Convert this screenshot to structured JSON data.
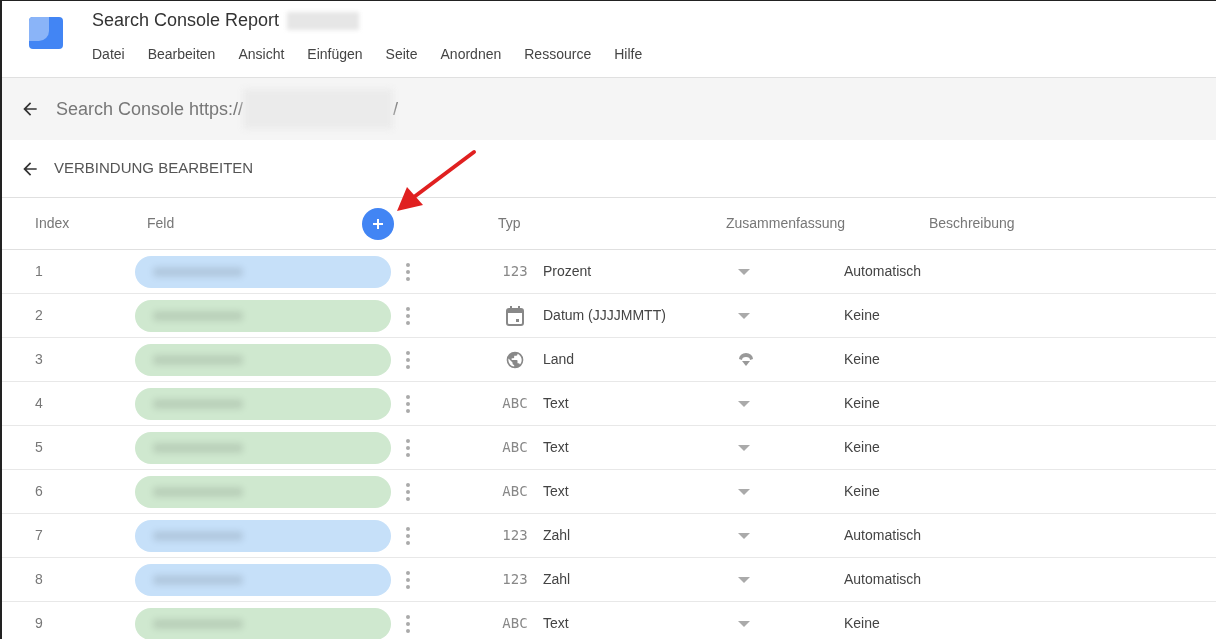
{
  "app": {
    "title": "Search Console Report",
    "menu": [
      "Datei",
      "Bearbeiten",
      "Ansicht",
      "Einfügen",
      "Seite",
      "Anordnen",
      "Ressource",
      "Hilfe"
    ]
  },
  "source_bar": {
    "label": "Search Console https://",
    "suffix": "/"
  },
  "section": {
    "title": "VERBINDUNG BEARBEITEN"
  },
  "table": {
    "columns": [
      "Index",
      "Feld",
      "Typ",
      "Zusammenfassung",
      "Beschreibung"
    ],
    "rows": [
      {
        "index": "1",
        "color": "#c6e0f9",
        "kind": "number",
        "glyph": "123",
        "type": "Prozent",
        "summary": "Automatisch"
      },
      {
        "index": "2",
        "color": "#cfe8cf",
        "kind": "date",
        "type": "Datum (JJJJMMTT)",
        "summary": "Keine"
      },
      {
        "index": "3",
        "color": "#cfe8cf",
        "kind": "geo",
        "type": "Land",
        "summary": "Keine"
      },
      {
        "index": "4",
        "color": "#cfe8cf",
        "kind": "text",
        "glyph": "ABC",
        "type": "Text",
        "summary": "Keine"
      },
      {
        "index": "5",
        "color": "#cfe8cf",
        "kind": "text",
        "glyph": "ABC",
        "type": "Text",
        "summary": "Keine"
      },
      {
        "index": "6",
        "color": "#cfe8cf",
        "kind": "text",
        "glyph": "ABC",
        "type": "Text",
        "summary": "Keine"
      },
      {
        "index": "7",
        "color": "#c6e0f9",
        "kind": "number",
        "glyph": "123",
        "type": "Zahl",
        "summary": "Automatisch"
      },
      {
        "index": "8",
        "color": "#c6e0f9",
        "kind": "number",
        "glyph": "123",
        "type": "Zahl",
        "summary": "Automatisch"
      },
      {
        "index": "9",
        "color": "#cfe8cf",
        "kind": "text",
        "glyph": "ABC",
        "type": "Text",
        "summary": "Keine"
      }
    ]
  }
}
